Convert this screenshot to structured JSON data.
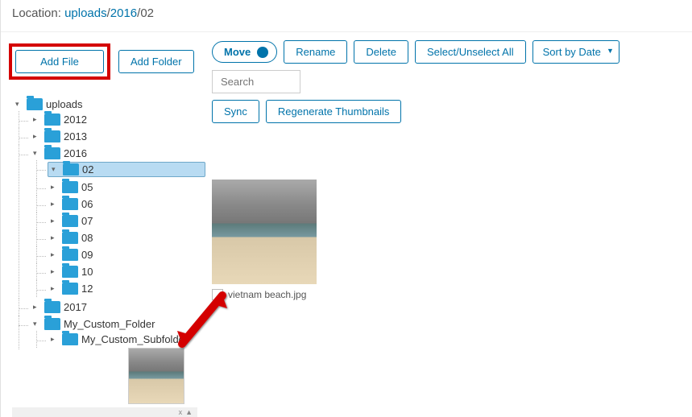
{
  "location": {
    "label": "Location:",
    "parts": [
      "uploads",
      "2016",
      "02"
    ]
  },
  "buttons": {
    "add_file": "Add File",
    "add_folder": "Add Folder",
    "move": "Move",
    "rename": "Rename",
    "delete": "Delete",
    "select_all": "Select/Unselect All",
    "sort": "Sort by Date",
    "sync": "Sync",
    "regen": "Regenerate Thumbnails"
  },
  "search": {
    "placeholder": "Search"
  },
  "tree": {
    "root": "uploads",
    "y2012": "2012",
    "y2013": "2013",
    "y2016": "2016",
    "m02": "02",
    "m05": "05",
    "m06": "06",
    "m07": "07",
    "m08": "08",
    "m09": "09",
    "m10": "10",
    "m12": "12",
    "y2017": "2017",
    "custom": "My_Custom_Folder",
    "custom_sub": "My_Custom_Subfolder"
  },
  "file": {
    "name": "vietnam beach.jpg"
  },
  "scroll": {
    "x": "x",
    "caret": "▲"
  }
}
